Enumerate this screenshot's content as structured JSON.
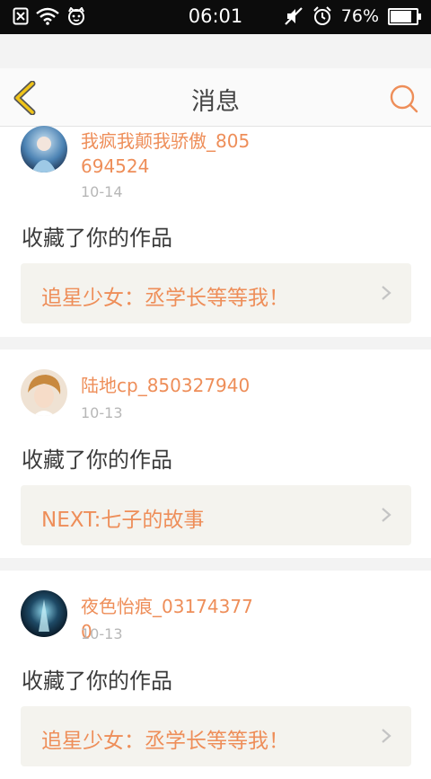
{
  "status_bar": {
    "time": "06:01",
    "battery": "76%",
    "battery_level": 0.76,
    "icons_left": [
      "sim-missing-icon",
      "wifi-icon",
      "cat-app-icon"
    ],
    "icons_right": [
      "mute-icon",
      "alarm-icon",
      "battery-icon"
    ]
  },
  "header": {
    "title": "消息",
    "back_icon": "chevron-left-icon",
    "search_icon": "search-icon",
    "accent": "#f0c419"
  },
  "messages": [
    {
      "username": "我疯我颠我骄傲_805694524",
      "date": "10-14",
      "action": "收藏了你的作品",
      "work_title": "追星少女：丞学长等等我！"
    },
    {
      "username": "陆地cp_850327940",
      "date": "10-13",
      "action": "收藏了你的作品",
      "work_title": "NEXT:七子的故事"
    },
    {
      "username": "夜色怡痕_031743770",
      "date": "10-13",
      "action": "收藏了你的作品",
      "work_title": "追星少女：丞学长等等我！"
    }
  ],
  "colors": {
    "accent_orange": "#ee8e59",
    "card_bg": "#f4f3ee"
  }
}
